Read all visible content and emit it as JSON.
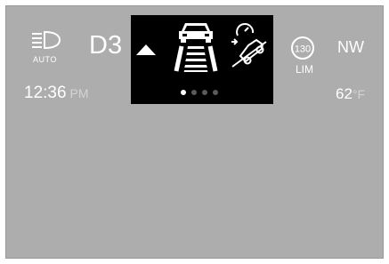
{
  "headlights": {
    "icon": "auto-headlight-icon",
    "label": "AUTO"
  },
  "gear": "D3",
  "popup": {
    "icons": [
      "arrow-up-icon",
      "lane-keep-assist-icon",
      "hill-descent-control-icon"
    ],
    "page_indicator": {
      "total": 4,
      "active": 1
    }
  },
  "speed_limiter": {
    "value": "130",
    "label": "LIM"
  },
  "compass": "NW",
  "time": {
    "value": "12:36",
    "period": "PM"
  },
  "temperature": {
    "value": "62",
    "unit": "°F"
  }
}
